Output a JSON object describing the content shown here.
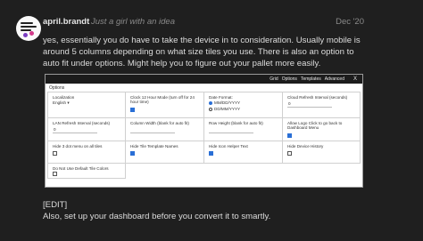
{
  "post": {
    "username": "april.brandt",
    "user_title": "Just a girl with an idea",
    "date": "Dec '20",
    "paragraph": "yes, essentially you do have to take the device in to consideration. Usually mobile is around 5 columns depending on what size tiles you use. There is also an option to auto fit under options. Might help you to figure out your pallet more easily.",
    "edit_tag": "[EDIT]",
    "edit_text": "Also, set up your dashboard before you convert it to smartly."
  },
  "screenshot": {
    "menu": [
      "Grid",
      "Options",
      "Templates",
      "Advanced"
    ],
    "close_label": "X",
    "section_title": "Options",
    "localization": {
      "label": "Localization",
      "value": "English"
    },
    "clock_12h": {
      "label": "Clock 12 Hour Mode (turn off for 24 hour time)",
      "checked": true
    },
    "date_format": {
      "label": "Date Format:",
      "options": [
        "MM/DD/YYYY",
        "DD/MM/YYYY"
      ],
      "selected": 0
    },
    "cloud_refresh": {
      "label": "Cloud Refresh Interval (seconds)",
      "value": "0"
    },
    "lan_refresh": {
      "label": "LAN Refresh Interval (seconds)",
      "value": "0"
    },
    "column_width": {
      "label": "Column Width (blank for auto fit)",
      "value": ""
    },
    "row_height": {
      "label": "Row Height (blank for auto fit)",
      "value": ""
    },
    "logo_click": {
      "label": "Allow Logo Click to go back to Dashboard Menu",
      "checked": true
    },
    "hide_3dot": {
      "label": "Hide 3 dot menu on all tiles",
      "checked": false
    },
    "hide_tile_names": {
      "label": "Hide Tile Template Names",
      "checked": true
    },
    "hide_icon_helper": {
      "label": "Hide Icon Helper Text",
      "checked": true
    },
    "hide_device_history": {
      "label": "Hide Device History",
      "checked": false
    },
    "no_default_tile_colors": {
      "label": "Do Not Use Default Tile Colors",
      "checked": false
    }
  }
}
